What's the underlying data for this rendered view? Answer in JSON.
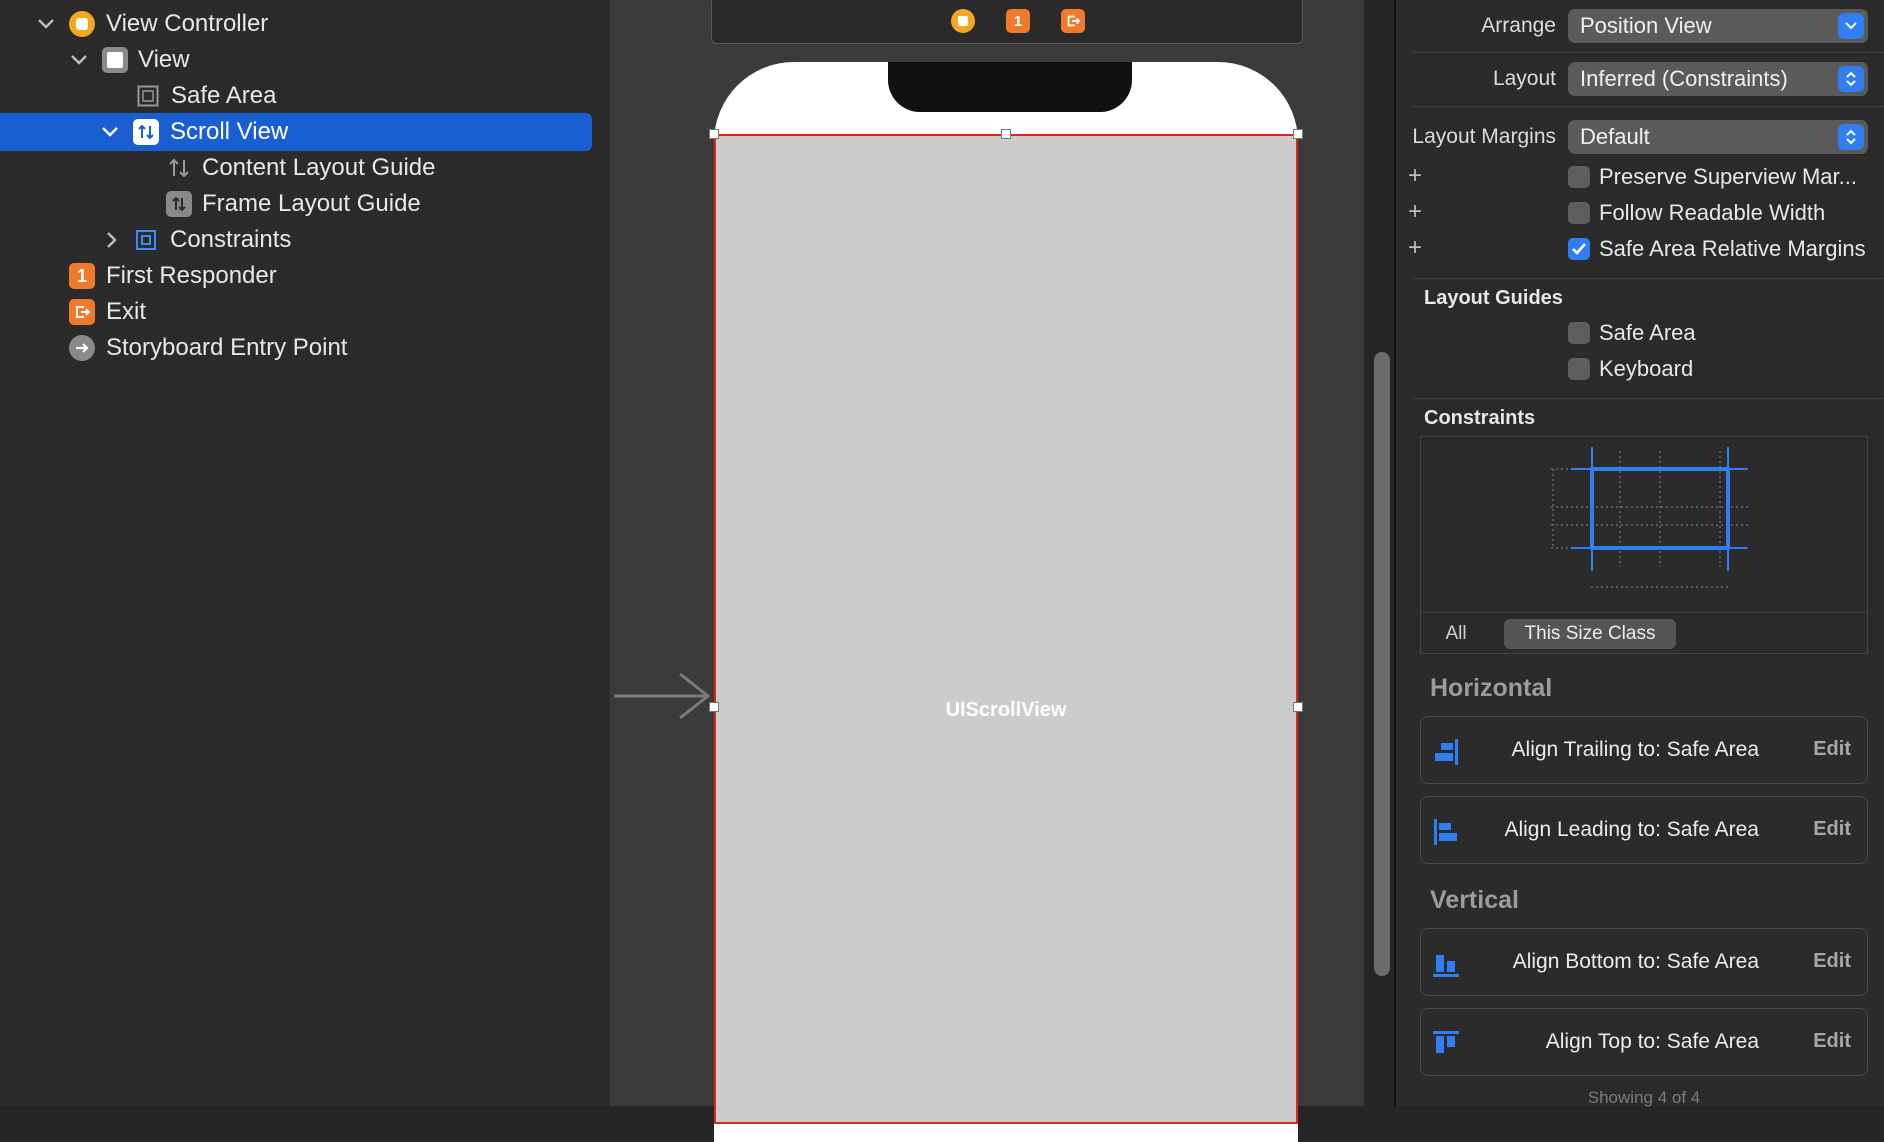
{
  "outline": {
    "items": [
      {
        "label": "View Controller",
        "icon": "view-controller-icon"
      },
      {
        "label": "View",
        "icon": "view-icon"
      },
      {
        "label": "Safe Area",
        "icon": "safe-area-icon"
      },
      {
        "label": "Scroll View",
        "icon": "scroll-view-icon",
        "selected": true
      },
      {
        "label": "Content Layout Guide",
        "icon": "content-layout-guide-icon"
      },
      {
        "label": "Frame Layout Guide",
        "icon": "frame-layout-guide-icon"
      },
      {
        "label": "Constraints",
        "icon": "constraints-icon"
      },
      {
        "label": "First Responder",
        "icon": "first-responder-icon"
      },
      {
        "label": "Exit",
        "icon": "exit-icon"
      },
      {
        "label": "Storyboard Entry Point",
        "icon": "entry-point-icon"
      }
    ]
  },
  "canvas": {
    "scene_icons": [
      "view-controller-icon",
      "first-responder-icon",
      "exit-icon"
    ],
    "first_responder_glyph": "1",
    "scroll_view_label": "UIScrollView"
  },
  "inspector": {
    "arrange_label": "Arrange",
    "arrange_value": "Position View",
    "layout_label": "Layout",
    "layout_value": "Inferred (Constraints)",
    "margins_label": "Layout Margins",
    "margins_value": "Default",
    "checkboxes": [
      {
        "label": "Preserve Superview Mar...",
        "checked": false
      },
      {
        "label": "Follow Readable Width",
        "checked": false
      },
      {
        "label": "Safe Area Relative Margins",
        "checked": true
      }
    ],
    "guides_header": "Layout Guides",
    "guides": [
      {
        "label": "Safe Area",
        "checked": false
      },
      {
        "label": "Keyboard",
        "checked": false
      }
    ],
    "constraints_header": "Constraints",
    "segments": {
      "all": "All",
      "size_class": "This Size Class"
    },
    "horizontal_header": "Horizontal",
    "vertical_header": "Vertical",
    "constraints": [
      {
        "text": "Align Trailing to:  Safe Area",
        "edit": "Edit",
        "icon": "align-trailing-icon"
      },
      {
        "text": "Align Leading to:  Safe Area",
        "edit": "Edit",
        "icon": "align-leading-icon"
      },
      {
        "text": "Align Bottom to:  Safe Area",
        "edit": "Edit",
        "icon": "align-bottom-icon"
      },
      {
        "text": "Align Top to:  Safe Area",
        "edit": "Edit",
        "icon": "align-top-icon"
      }
    ],
    "showing": "Showing 4 of 4"
  },
  "colors": {
    "selection": "#1a5fd1",
    "accent": "#2f7ff2",
    "constraint_red": "#e0271e",
    "view_controller": "#f5a623",
    "first_responder": "#f07a2c"
  }
}
